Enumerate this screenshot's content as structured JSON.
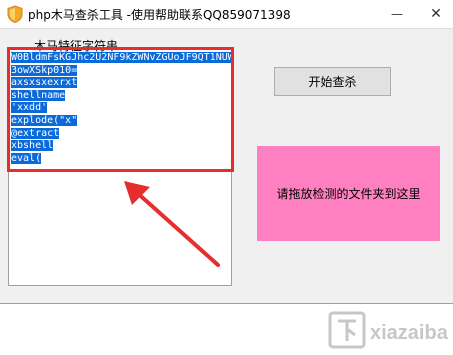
{
  "window": {
    "title": "php木马查杀工具  -使用帮助联系QQ859071398",
    "minimize_glyph": "—",
    "close_glyph": "✕"
  },
  "signatures": {
    "label": "木马特征字符串",
    "lines": [
      "W0BldmFsKGJhc2U2NF9kZWNvZGUoJF9QT1NUW",
      "3owXSkp010=",
      "axsxsxexrxt",
      "shellname",
      "'xxdd'",
      "explode(\"x\"",
      "@extract",
      "xbshell",
      "eval("
    ]
  },
  "actions": {
    "start_scan_label": "开始查杀"
  },
  "drop_zone": {
    "label": "请拖放检测的文件夹到这里",
    "color": "#ff80c0"
  },
  "annotation": {
    "highlight_color": "#e62e2e",
    "arrow_color": "#e62e2e"
  },
  "watermark": {
    "text": "下载吧"
  }
}
